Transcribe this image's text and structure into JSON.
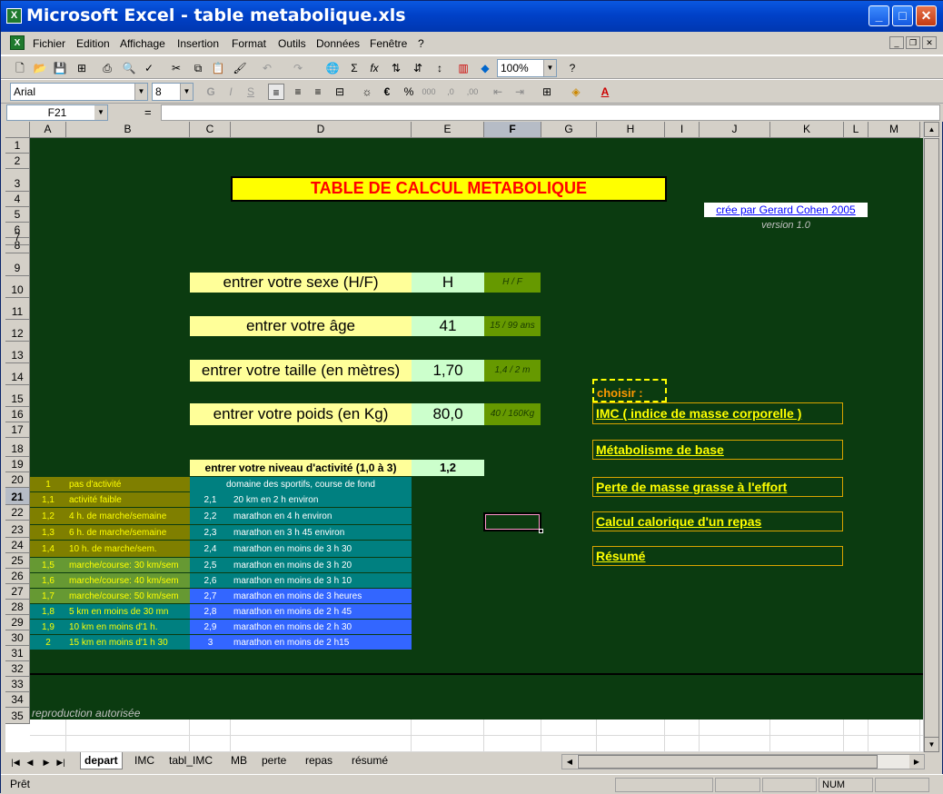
{
  "window": {
    "title": "Microsoft Excel - table metabolique.xls",
    "app_icon": "excel-icon"
  },
  "menu": [
    "Fichier",
    "Edition",
    "Affichage",
    "Insertion",
    "Format",
    "Outils",
    "Données",
    "Fenêtre",
    "?"
  ],
  "toolbar1": {
    "zoom": "100%"
  },
  "toolbar2": {
    "font": "Arial",
    "size": "8"
  },
  "formula_bar": {
    "cell_ref": "F21",
    "fx": "=",
    "content": ""
  },
  "columns": [
    "A",
    "B",
    "C",
    "D",
    "E",
    "F",
    "G",
    "H",
    "I",
    "J",
    "K",
    "L",
    "M"
  ],
  "selected_column": "F",
  "rows": [
    "1",
    "2",
    "3",
    "4",
    "5",
    "6",
    "7",
    "8",
    "9",
    "10",
    "11",
    "12",
    "13",
    "14",
    "15",
    "16",
    "17",
    "18",
    "19",
    "20",
    "21",
    "22",
    "23",
    "24",
    "25",
    "26",
    "27",
    "28",
    "29",
    "30",
    "31",
    "32",
    "33",
    "34",
    "35"
  ],
  "selected_row": "21",
  "sheet": {
    "title": "TABLE DE CALCUL METABOLIQUE",
    "credit": "crée par Gerard Cohen 2005",
    "version": "version 1.0",
    "fields": [
      {
        "label": "entrer votre sexe (H/F)",
        "value": "H",
        "hint": "H / F"
      },
      {
        "label": "entrer votre âge",
        "value": "41",
        "hint": "15 / 99 ans"
      },
      {
        "label": "entrer votre taille (en mètres)",
        "value": "1,70",
        "hint": "1,4 / 2 m"
      },
      {
        "label": "entrer votre poids (en Kg)",
        "value": "80,0",
        "hint": "40 / 160Kg"
      }
    ],
    "activity_label": "entrer votre niveau d'activité (1,0 à 3)",
    "activity_value": "1,2",
    "sport_header": "domaine des sportifs, course de fond",
    "activity_table": [
      {
        "n": "1",
        "desc": "pas d'activité"
      },
      {
        "n": "1,1",
        "desc": "activité faible"
      },
      {
        "n": "1,2",
        "desc": "4 h. de marche/semaine"
      },
      {
        "n": "1,3",
        "desc": "6 h. de marche/semaine"
      },
      {
        "n": "1,4",
        "desc": "10 h. de marche/sem."
      },
      {
        "n": "1,5",
        "desc": "marche/course: 30 km/sem"
      },
      {
        "n": "1,6",
        "desc": "marche/course: 40 km/sem"
      },
      {
        "n": "1,7",
        "desc": "marche/course: 50 km/sem"
      },
      {
        "n": "1,8",
        "desc": "5 km en moins de 30 mn"
      },
      {
        "n": "1,9",
        "desc": "10 km en moins d'1 h."
      },
      {
        "n": "2",
        "desc": "15 km en moins d'1 h 30"
      }
    ],
    "sport_table": [
      {
        "n": "2,1",
        "desc": "20 km en 2 h environ"
      },
      {
        "n": "2,2",
        "desc": "marathon en 4 h environ"
      },
      {
        "n": "2,3",
        "desc": "marathon en 3 h 45 environ"
      },
      {
        "n": "2,4",
        "desc": "marathon en moins de 3 h 30"
      },
      {
        "n": "2,5",
        "desc": "marathon en moins de 3 h 20"
      },
      {
        "n": "2,6",
        "desc": "marathon en moins de 3 h 10"
      },
      {
        "n": "2,7",
        "desc": "marathon en moins de 3 heures"
      },
      {
        "n": "2,8",
        "desc": "marathon en moins de 2 h 45"
      },
      {
        "n": "2,9",
        "desc": "marathon en moins de 2 h 30"
      },
      {
        "n": "3",
        "desc": "marathon en moins de 2 h15"
      }
    ],
    "choose_label": "choisir :",
    "links": [
      "IMC ( indice de masse corporelle )",
      "Métabolisme de base",
      "Perte de masse grasse à l'effort",
      "Calcul calorique d'un repas",
      "Résumé"
    ],
    "footer": "reproduction autorisée"
  },
  "tabs": [
    "depart",
    "IMC",
    "tabl_IMC",
    "MB",
    "perte",
    "repas",
    "résumé"
  ],
  "active_tab": "depart",
  "status": {
    "left": "Prêt",
    "num": "NUM"
  },
  "colors": {
    "sheet_bg": "#0b3b10",
    "title_text": "#ff0000",
    "title_bg": "#ffff00",
    "link_text": "#ffff00"
  }
}
